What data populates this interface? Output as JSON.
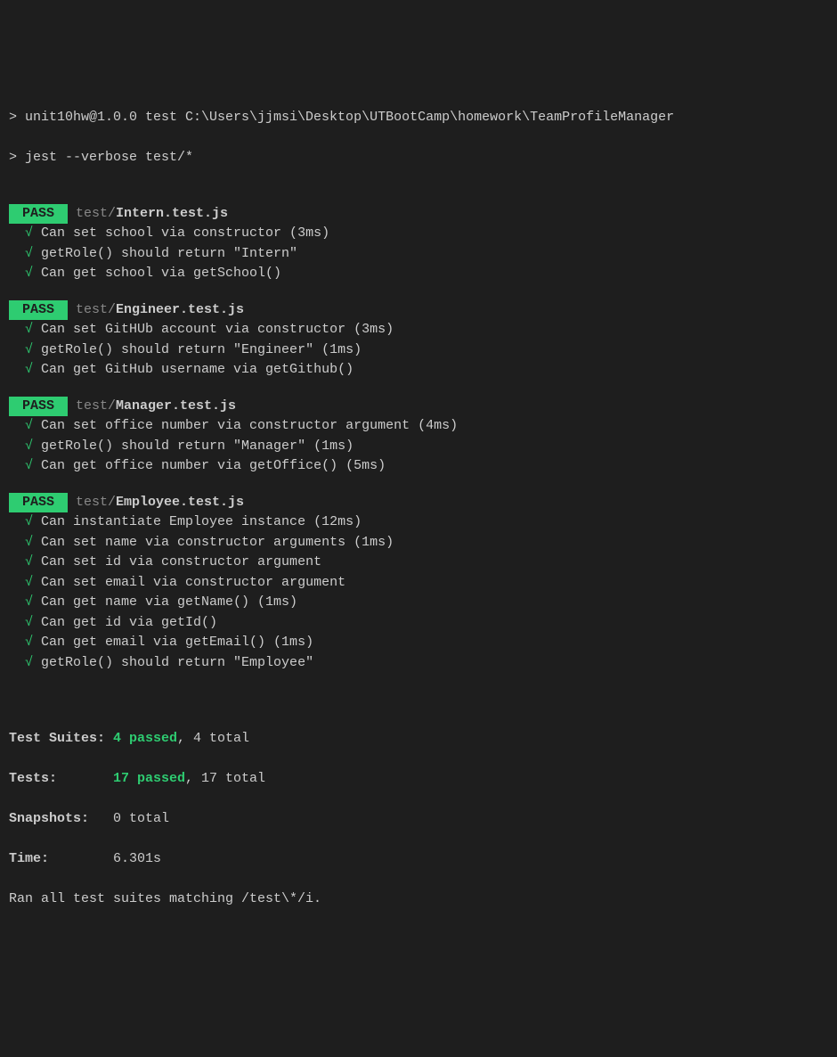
{
  "prompt": {
    "line1": "> unit10hw@1.0.0 test C:\\Users\\jjmsi\\Desktop\\UTBootCamp\\homework\\TeamProfileManager",
    "line2": "> jest --verbose test/*"
  },
  "suites": [
    {
      "badge": "PASS",
      "path_prefix": "test/",
      "file": "Intern.test.js",
      "tests": [
        "Can set school via constructor (3ms)",
        "getRole() should return \"Intern\"",
        "Can get school via getSchool()"
      ]
    },
    {
      "badge": "PASS",
      "path_prefix": "test/",
      "file": "Engineer.test.js",
      "tests": [
        "Can set GitHUb account via constructor (3ms)",
        "getRole() should return \"Engineer\" (1ms)",
        "Can get GitHub username via getGithub()"
      ]
    },
    {
      "badge": "PASS",
      "path_prefix": "test/",
      "file": "Manager.test.js",
      "tests": [
        "Can set office number via constructor argument (4ms)",
        "getRole() should return \"Manager\" (1ms)",
        "Can get office number via getOffice() (5ms)"
      ]
    },
    {
      "badge": "PASS",
      "path_prefix": "test/",
      "file": "Employee.test.js",
      "tests": [
        "Can instantiate Employee instance (12ms)",
        "Can set name via constructor arguments (1ms)",
        "Can set id via constructor argument",
        "Can set email via constructor argument",
        "Can get name via getName() (1ms)",
        "Can get id via getId()",
        "Can get email via getEmail() (1ms)",
        "getRole() should return \"Employee\""
      ]
    }
  ],
  "summary": {
    "suites_label": "Test Suites: ",
    "suites_passed": "4 passed",
    "suites_rest": ", 4 total",
    "tests_label": "Tests:       ",
    "tests_passed": "17 passed",
    "tests_rest": ", 17 total",
    "snapshots_label": "Snapshots:   ",
    "snapshots_rest": "0 total",
    "time_label": "Time:        ",
    "time_rest": "6.301s",
    "final_line": "Ran all test suites matching /test\\*/i."
  },
  "check_glyph": "√"
}
